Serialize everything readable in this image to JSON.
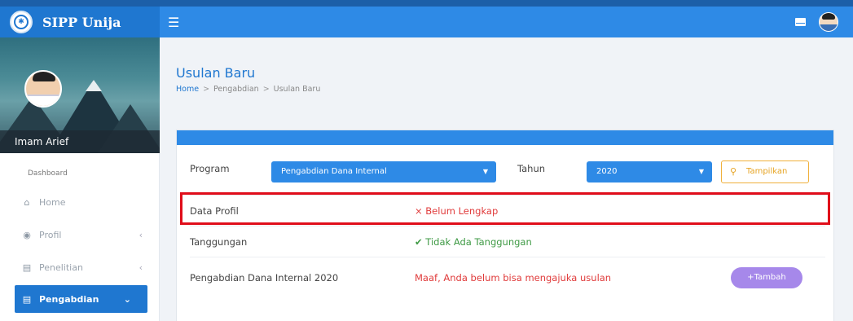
{
  "app": {
    "title": "SIPP Unija"
  },
  "header": {
    "menu_icon": "hamburger-icon",
    "mail_icon": "mail-icon",
    "avatar_icon": "user-avatar"
  },
  "sidebar": {
    "user_name": "Imam Arief",
    "section_label": "Dashboard",
    "items": [
      {
        "label": "Home",
        "icon": "home-icon",
        "chevron": ""
      },
      {
        "label": "Profil",
        "icon": "user-circle-icon",
        "chevron": "‹"
      },
      {
        "label": "Penelitian",
        "icon": "doc-icon",
        "chevron": "‹"
      },
      {
        "label": "Pengabdian",
        "icon": "doc-icon",
        "chevron": "⌄"
      }
    ]
  },
  "page": {
    "title": "Usulan Baru",
    "breadcrumb": [
      "Home",
      ">",
      "Pengabdian",
      ">",
      "Usulan Baru"
    ]
  },
  "filter": {
    "program_label": "Program",
    "program_value": "Pengabdian Dana Internal",
    "tahun_label": "Tahun",
    "tahun_value": "2020",
    "button_label": "Tampilkan"
  },
  "rows": [
    {
      "label": "Data Profil",
      "status": "× Belum Lengkap",
      "status_color": "#e03b3b"
    },
    {
      "label": "Tanggungan",
      "status": "✔ Tidak Ada Tanggungan",
      "status_color": "#3f9a45"
    },
    {
      "label": "Pengabdian Dana Internal 2020",
      "status": "Maaf, Anda belum bisa mengajuka usulan",
      "status_color": "#e03b3b",
      "button": "+Tambah"
    }
  ],
  "colors": {
    "primary": "#2e8ae6",
    "highlight": "#e00d1a",
    "warning": "#f0b03b",
    "purple": "#a688ea"
  }
}
